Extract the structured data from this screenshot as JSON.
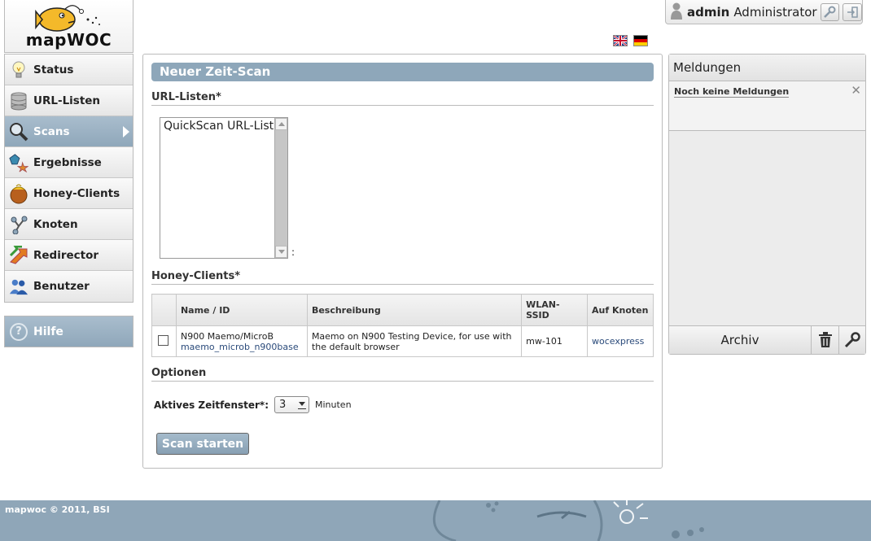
{
  "app": {
    "logo_text": "mapWOC"
  },
  "user": {
    "name": "admin",
    "role": "Administrator"
  },
  "nav": {
    "items": [
      {
        "label": "Status",
        "icon": "lightbulb-icon",
        "active": false
      },
      {
        "label": "URL-Listen",
        "icon": "database-icon",
        "active": false
      },
      {
        "label": "Scans",
        "icon": "magnifier-icon",
        "active": true
      },
      {
        "label": "Ergebnisse",
        "icon": "shapes-icon",
        "active": false
      },
      {
        "label": "Honey-Clients",
        "icon": "honey-pot-icon",
        "active": false
      },
      {
        "label": "Knoten",
        "icon": "nodes-icon",
        "active": false
      },
      {
        "label": "Redirector",
        "icon": "redirect-arrows-icon",
        "active": false
      },
      {
        "label": "Benutzer",
        "icon": "users-icon",
        "active": false
      }
    ],
    "help_label": "Hilfe"
  },
  "main": {
    "title": "Neuer Zeit-Scan",
    "url_section": "URL-Listen*",
    "url_options": [
      "QuickScan URL-List"
    ],
    "url_suffix": ":",
    "hc_section": "Honey-Clients*",
    "hc_table": {
      "headers": [
        "",
        "Name / ID",
        "Beschreibung",
        "WLAN-SSID",
        "Auf Knoten"
      ],
      "rows": [
        {
          "name": "N900 Maemo/MicroB",
          "id": "maemo_microb_n900base",
          "description": "Maemo on N900 Testing Device, for use with the default browser",
          "ssid": "mw-101",
          "node": "wocexpress"
        }
      ]
    },
    "options_section": "Optionen",
    "window_label": "Aktives Zeitfenster*:",
    "window_value": "3",
    "window_unit": "Minuten",
    "start_button": "Scan starten"
  },
  "messages": {
    "title": "Meldungen",
    "empty_text": "Noch keine Meldungen",
    "archive_label": "Archiv"
  },
  "footer": {
    "copyright": "mapwoc © 2011, BSI"
  },
  "colors": {
    "accent": "#8ea7ba",
    "link": "#2a4a7a"
  }
}
